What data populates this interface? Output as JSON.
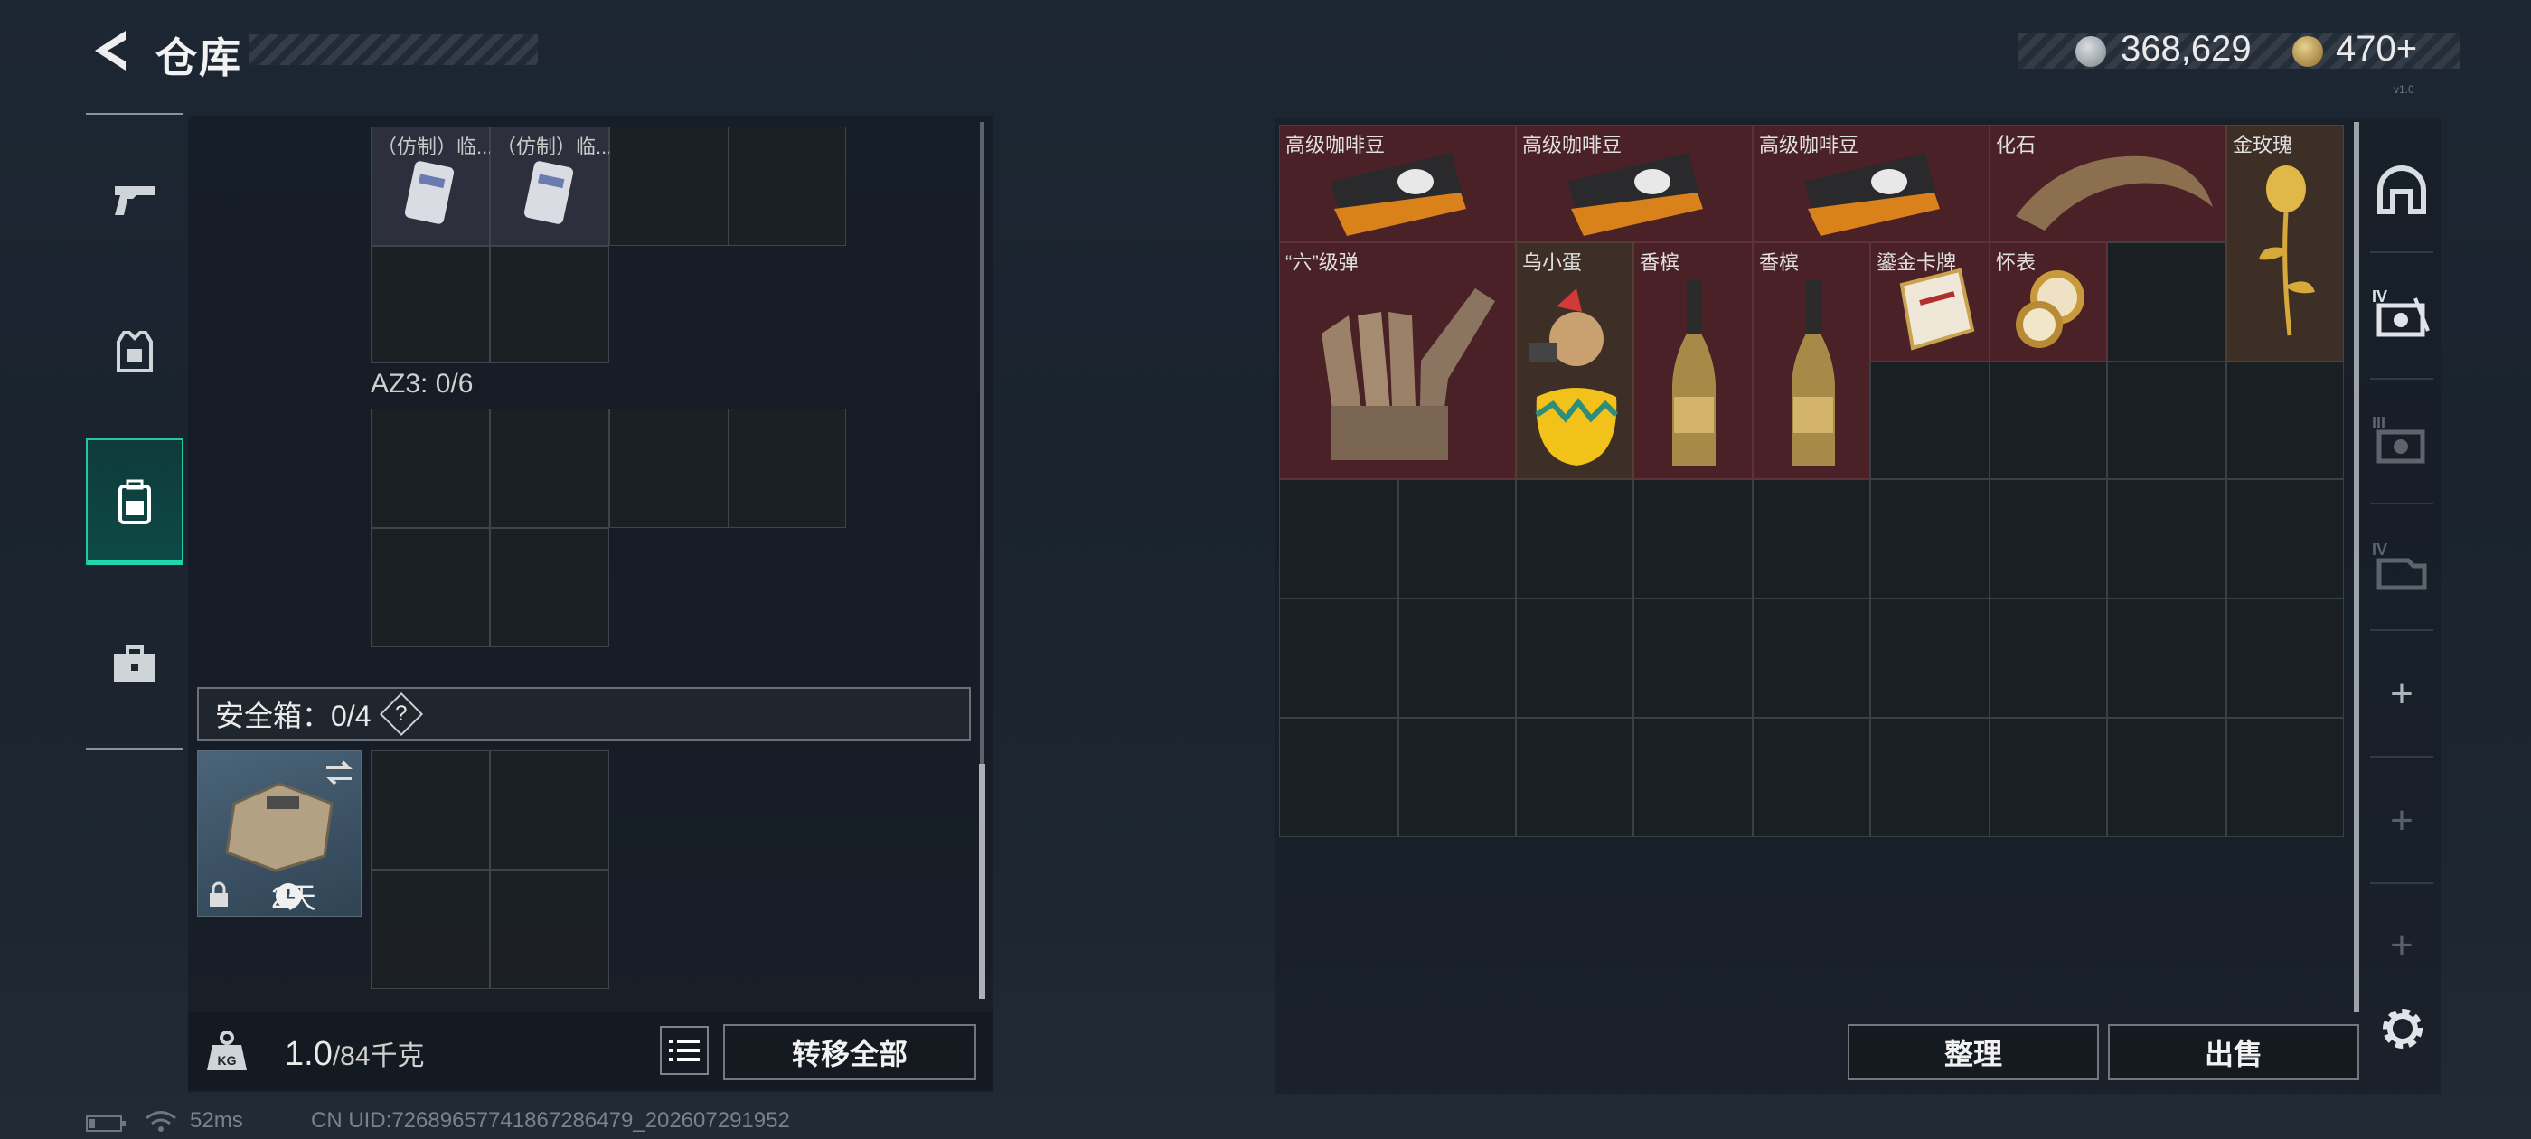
{
  "header": {
    "title": "仓库",
    "currency1": "368,629",
    "currency2": "470+",
    "version": "v1.0"
  },
  "nav": {
    "items": [
      {
        "icon": "gun-icon",
        "active": false
      },
      {
        "icon": "armor-vest-icon",
        "active": false
      },
      {
        "icon": "backpack-icon",
        "active": true
      },
      {
        "icon": "briefcase-icon",
        "active": false
      }
    ]
  },
  "left": {
    "top_items": [
      {
        "label": "（仿制）临..."
      },
      {
        "label": "（仿制）临..."
      }
    ],
    "az3_label": "AZ3: 0/6",
    "safe_label": "安全箱：0/4",
    "safe_help": "?",
    "safebox_timer": "2天",
    "weight_value": "1.0",
    "weight_max": "/84千克",
    "transfer_all": "转移全部"
  },
  "right": {
    "items": [
      {
        "label": "高级咖啡豆",
        "kind": "coffee"
      },
      {
        "label": "高级咖啡豆",
        "kind": "coffee"
      },
      {
        "label": "高级咖啡豆",
        "kind": "coffee"
      },
      {
        "label": "化石",
        "kind": "fossil"
      },
      {
        "label": "金玫瑰",
        "kind": "rose"
      },
      {
        "label": "“六”级弹",
        "kind": "hand"
      },
      {
        "label": "乌小蛋",
        "kind": "egg"
      },
      {
        "label": "香槟",
        "kind": "champagne"
      },
      {
        "label": "香槟",
        "kind": "champagne"
      },
      {
        "label": "鎏金卡牌",
        "kind": "card"
      },
      {
        "label": "怀表",
        "kind": "watch"
      }
    ],
    "sort_button": "整理",
    "sell_button": "出售",
    "side_icons": [
      "helmet-icon",
      "armor-4-icon",
      "armor-3-icon",
      "rig-4-icon"
    ]
  },
  "status_bar": {
    "ping": "52ms",
    "uid": "CN UID:72689657741867286479_202607291952"
  }
}
